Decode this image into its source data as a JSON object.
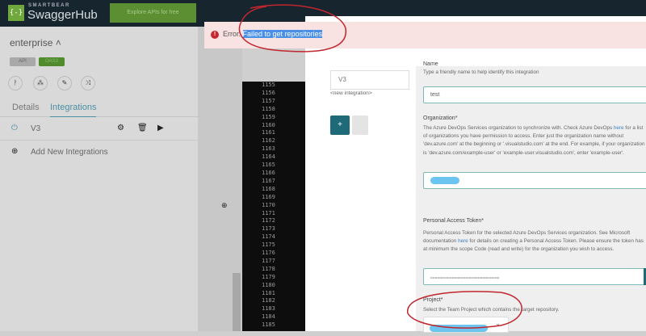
{
  "header": {
    "brand_small": "SMARTBEAR",
    "brand": "SwaggerHub",
    "logo": "{-}",
    "explore": "Explore APIs for free"
  },
  "project": {
    "name": "enterprise ˄",
    "badges": [
      "API",
      "OAS3"
    ]
  },
  "tabs": [
    "Details",
    "Integrations"
  ],
  "integrations": [
    {
      "name": "V3"
    }
  ],
  "add_integration": "Add New Integrations",
  "line_numbers": [
    "1155",
    "1156",
    "1157",
    "1158",
    "1159",
    "1160",
    "1161",
    "1162",
    "1163",
    "1164",
    "1165",
    "1166",
    "1167",
    "1168",
    "1169",
    "1170",
    "1171",
    "1172",
    "1173",
    "1174",
    "1175",
    "1176",
    "1177",
    "1178",
    "1179",
    "1180",
    "1181",
    "1182",
    "1183",
    "1184",
    "1185"
  ],
  "modal": {
    "list_item": "V3",
    "new_integration": "<new integration>",
    "add_btn": "+",
    "name_label": "Name",
    "name_desc": "Type a friendly name to help identify this integration",
    "name_value": "test",
    "org_label": "Organization*",
    "org_desc_pre": "The Azure DevOps Services organization to synchronize with. Check Azure DevOps ",
    "org_link": "here",
    "org_desc_post": " for a list of organizations you have permission to access. Enter just the organization name without 'dev.azure.com' at the beginning or '.visualstudio.com' at the end. For example, if your organization is 'dev.azure.com/example-user' or 'example-user.visualstudio.com', enter 'example-user'.",
    "pat_label": "Personal Access Token*",
    "pat_desc_pre": "Personal Access Token for the selected Azure DevOps Services organization. See Microsoft documentation ",
    "pat_link": "here",
    "pat_desc_post": " for details on creating a Personal Access Token. Please ensure the token has at minimum the scope Code (read and write) for the organization you wish to access.",
    "pat_value": "•••••••••••••••••••••••••••••••••••••••••••••••••••••••••••••",
    "project_label": "Project*",
    "project_desc": "Select the Team Project which contains the target repository."
  },
  "toast": {
    "prefix": "Error.",
    "message": "Failed to get repositories"
  },
  "colors": {
    "header": "#17252f",
    "accent": "#1f6a78",
    "error": "#c6262e"
  }
}
